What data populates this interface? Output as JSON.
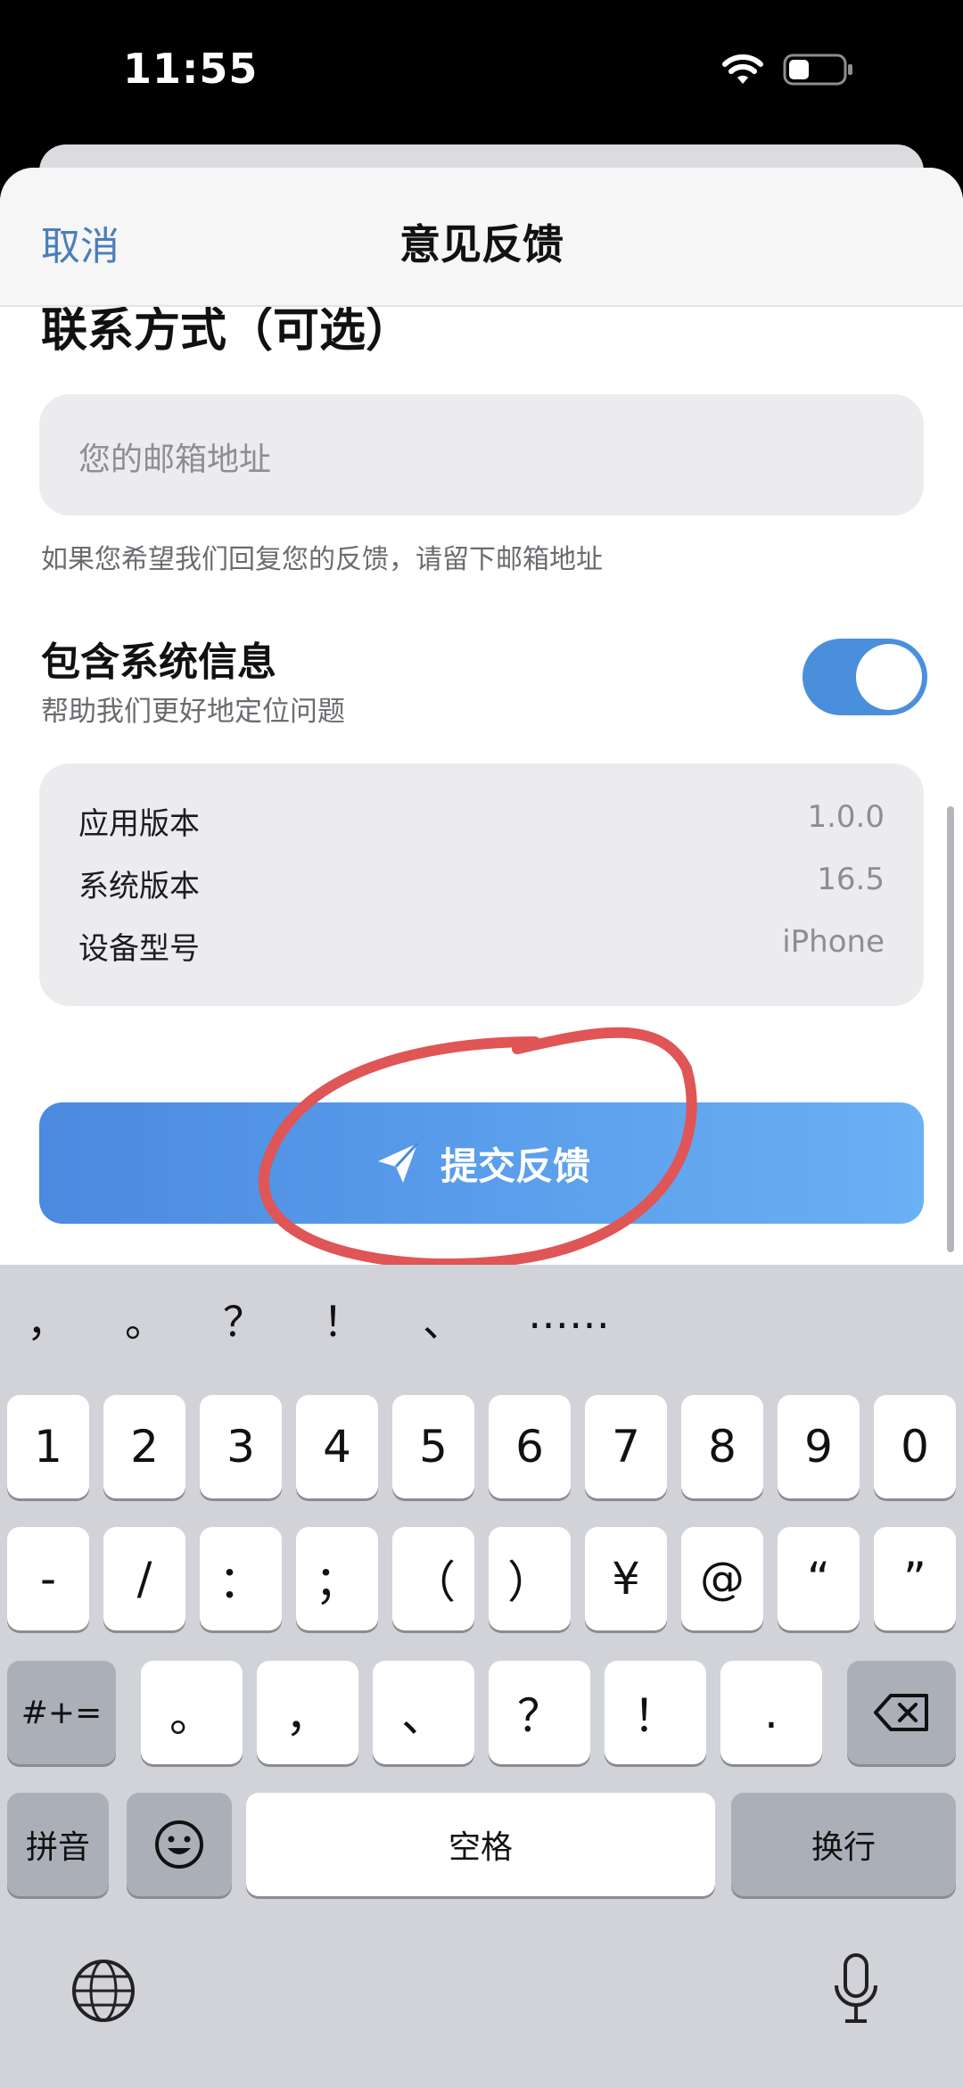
{
  "status": {
    "time": "11:55",
    "icons": [
      "wifi-icon",
      "battery-icon"
    ]
  },
  "nav": {
    "cancel": "取消",
    "title": "意见反馈"
  },
  "contact": {
    "section_title": "联系方式（可选）",
    "email_placeholder": "您的邮箱地址",
    "hint": "如果您希望我们回复您的反馈，请留下邮箱地址"
  },
  "system_info": {
    "title": "包含系统信息",
    "subtitle": "帮助我们更好地定位问题",
    "toggle_on": true,
    "rows": [
      {
        "label": "应用版本",
        "value": "1.0.0"
      },
      {
        "label": "系统版本",
        "value": "16.5"
      },
      {
        "label": "设备型号",
        "value": "iPhone"
      }
    ]
  },
  "submit": {
    "label": "提交反馈",
    "icon": "send-icon"
  },
  "colors": {
    "accent": "#4a8ae0",
    "cancel_link": "#4a7fb8",
    "annotation": "#e05555"
  },
  "keyboard": {
    "candidates": [
      "，",
      "。",
      "？",
      "！",
      "、",
      "……"
    ],
    "row1": [
      "1",
      "2",
      "3",
      "4",
      "5",
      "6",
      "7",
      "8",
      "9",
      "0"
    ],
    "row2": [
      "-",
      "/",
      "：",
      "；",
      "（",
      "）",
      "¥",
      "@",
      "“",
      "”"
    ],
    "row3_mode": "#+=",
    "row3": [
      "。",
      "，",
      "、",
      "？",
      "！",
      "."
    ],
    "row4_pinyin": "拼音",
    "row4_space": "空格",
    "row4_return": "换行",
    "icons": [
      "emoji-icon",
      "delete-icon",
      "globe-icon",
      "mic-icon"
    ]
  }
}
